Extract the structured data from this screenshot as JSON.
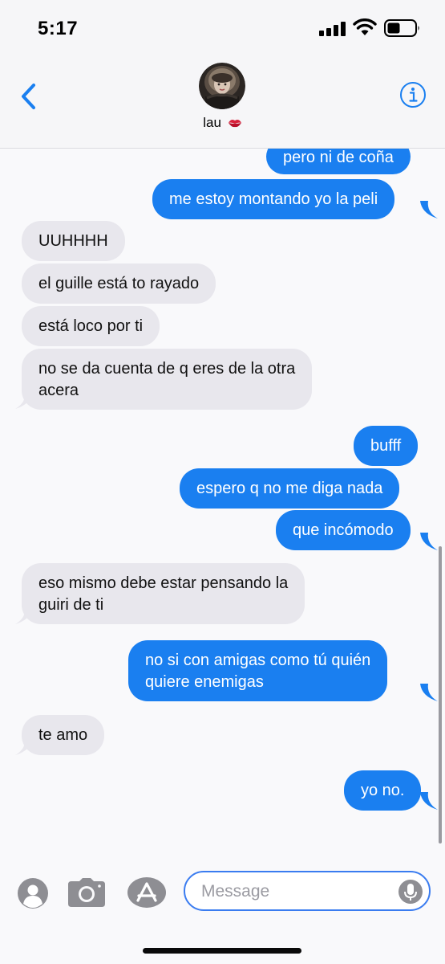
{
  "status_bar": {
    "time": "5:17"
  },
  "header": {
    "contact_name": "lau"
  },
  "messages": [
    {
      "text": "pero ni de coña",
      "direction": "outgoing"
    },
    {
      "text": "me estoy montando yo la peli",
      "direction": "outgoing"
    },
    {
      "text": "UUHHHH",
      "direction": "incoming"
    },
    {
      "text": "el guille está to rayado",
      "direction": "incoming"
    },
    {
      "text": "está loco por ti",
      "direction": "incoming"
    },
    {
      "lines": [
        "no se da cuenta de q eres de la otra",
        "acera"
      ],
      "direction": "incoming"
    },
    {
      "text": "bufff",
      "direction": "outgoing"
    },
    {
      "text": "espero q no me diga nada",
      "direction": "outgoing"
    },
    {
      "text": "que incómodo",
      "direction": "outgoing"
    },
    {
      "lines": [
        "eso mismo debe estar pensando la",
        "guiri de ti"
      ],
      "direction": "incoming"
    },
    {
      "lines": [
        "no si con amigas como tú quién",
        "quiere enemigas"
      ],
      "direction": "outgoing"
    },
    {
      "text": "te amo",
      "direction": "incoming"
    },
    {
      "text": "yo no.",
      "direction": "outgoing"
    }
  ],
  "composer": {
    "placeholder": "Message"
  },
  "colors": {
    "outgoing_bubble": "#1a7ff0",
    "incoming_bubble": "#e8e7ed",
    "accent": "#1a7ff0"
  },
  "icons": {
    "back": "chevron-left-icon",
    "info": "info-icon",
    "contact_emoji": "kiss-mark-icon",
    "tools": [
      "memoji-icon",
      "camera-icon",
      "app-store-icon"
    ],
    "mic": "microphone-icon"
  }
}
